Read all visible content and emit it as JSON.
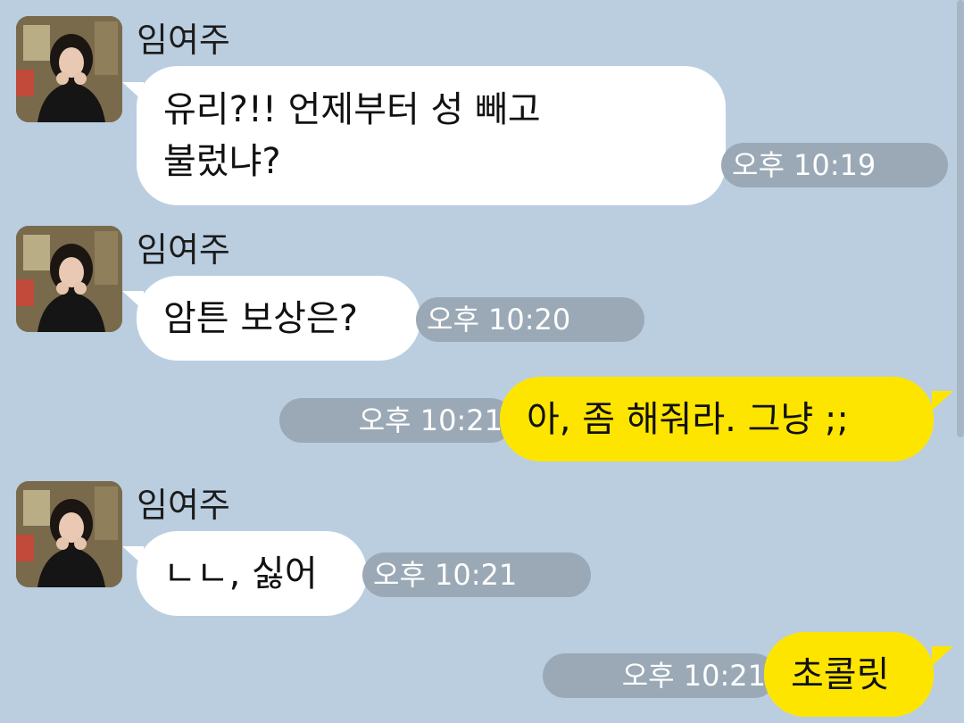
{
  "messages": [
    {
      "sender": "임여주",
      "direction": "incoming",
      "text_lines": [
        "유리?!! 언제부터 성 빼고",
        "불렀냐?"
      ],
      "time": "오후 10:19"
    },
    {
      "sender": "임여주",
      "direction": "incoming",
      "text_lines": [
        "암튼 보상은?"
      ],
      "time": "오후 10:20"
    },
    {
      "direction": "outgoing",
      "text_lines": [
        "아, 좀 해줘라. 그냥 ;;"
      ],
      "time": "오후 10:21"
    },
    {
      "sender": "임여주",
      "direction": "incoming",
      "text_lines": [
        "ㄴㄴ, 싫어"
      ],
      "time": "오후 10:21"
    },
    {
      "direction": "outgoing",
      "text_lines": [
        "초콜릿"
      ],
      "time": "오후 10:21"
    }
  ],
  "colors": {
    "background": "#bacee0",
    "incoming_bubble": "#ffffff",
    "outgoing_bubble": "#fee500",
    "time_pill": "#9ba9b6"
  },
  "avatar_icon": "profile-photo"
}
